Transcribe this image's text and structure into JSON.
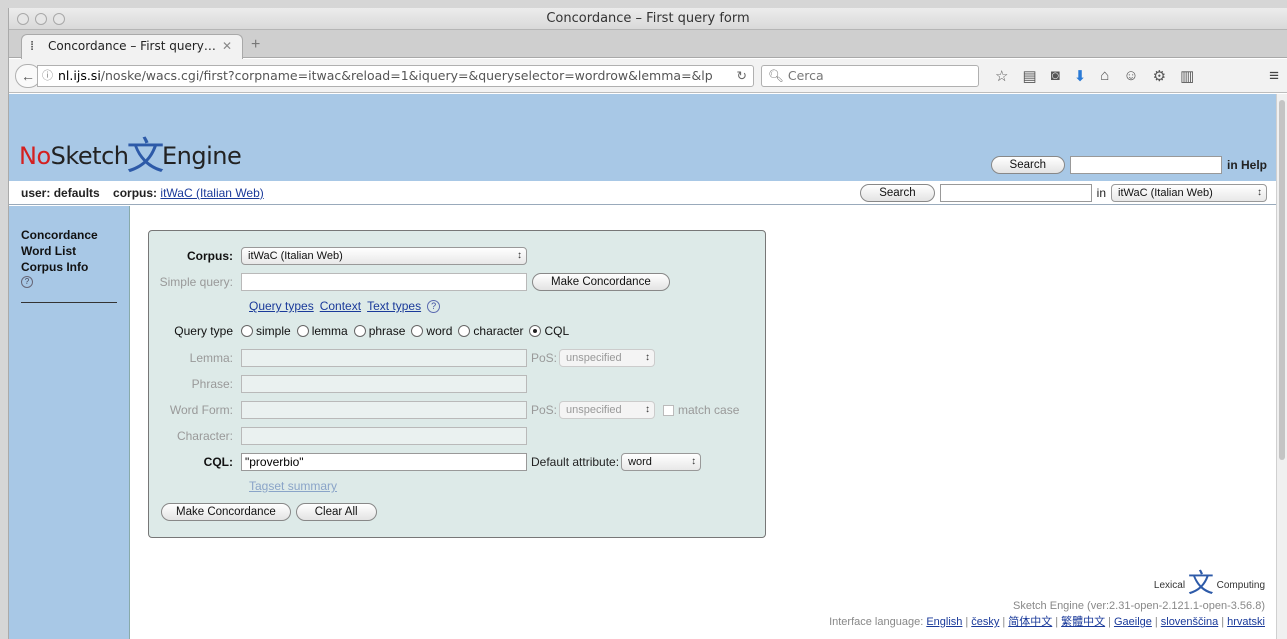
{
  "window": {
    "title": "Concordance – First query form"
  },
  "tab": {
    "label": "Concordance – First query…",
    "close": "✕",
    "new_tab": "+"
  },
  "nav": {
    "url_domain": "nl.ijs.si",
    "url_rest": "/noske/wacs.cgi/first?corpname=itwac&reload=1&iquery=&queryselector=wordrow&lemma=&lp",
    "search_placeholder": "Cerca"
  },
  "header": {
    "logo_no": "No",
    "logo_sketch": "Sketch",
    "logo_glyph": "文",
    "logo_engine": "Engine",
    "help_search_button": "Search",
    "help_search_value": "",
    "in_help": "in Help"
  },
  "userbar": {
    "user_label": "user:",
    "user_value": "defaults",
    "corpus_label": "corpus:",
    "corpus_value": "itWaC (Italian Web)",
    "search_button": "Search",
    "search_value": "",
    "in_label": "in",
    "corpus_select": "itWaC (Italian Web)"
  },
  "sidebar": {
    "items": [
      {
        "label": "Concordance"
      },
      {
        "label": "Word List"
      },
      {
        "label": "Corpus Info"
      }
    ],
    "help": "?"
  },
  "form": {
    "corpus_label": "Corpus:",
    "corpus_value": "itWaC (Italian Web)",
    "simple_query_label": "Simple query:",
    "simple_query_value": "",
    "make_concordance_top": "Make Concordance",
    "links": [
      "Query types",
      "Context",
      "Text types"
    ],
    "help": "?",
    "query_type_label": "Query type",
    "query_types": [
      "simple",
      "lemma",
      "phrase",
      "word",
      "character",
      "CQL"
    ],
    "query_type_selected": "CQL",
    "lemma_label": "Lemma:",
    "pos_label": "PoS:",
    "pos_value": "unspecified",
    "phrase_label": "Phrase:",
    "word_form_label": "Word Form:",
    "match_case": "match case",
    "character_label": "Character:",
    "cql_label": "CQL:",
    "cql_value": "\"proverbio\"",
    "default_attribute_label": "Default attribute:",
    "default_attribute_value": "word",
    "tagset_summary": "Tagset summary",
    "make_concordance": "Make Concordance",
    "clear_all": "Clear All"
  },
  "footer": {
    "lexical": "Lexical",
    "computing": "Computing",
    "glyph": "文",
    "version": "Sketch Engine (ver:2.31-open-2.121.1-open-3.56.8)",
    "interface_label": "Interface language:",
    "languages": [
      "English",
      "česky",
      "简体中文",
      "繁體中文",
      "Gaeilge",
      "slovenščina",
      "hrvatski"
    ]
  }
}
